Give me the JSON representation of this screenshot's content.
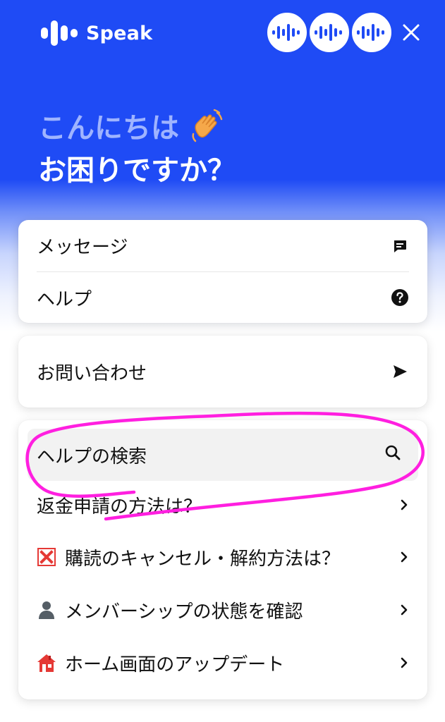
{
  "header": {
    "brand_name": "Speak",
    "accent_color": "#1f4bf5",
    "avatar_count": 3,
    "close_icon": "close-icon"
  },
  "greeting": {
    "line1": "こんにちは",
    "line2": "お困りですか？",
    "emoji": "waving-hand-icon"
  },
  "menu_card": {
    "items": [
      {
        "label": "メッセージ",
        "icon": "message-icon"
      },
      {
        "label": "ヘルプ",
        "icon": "help-circle-icon"
      }
    ]
  },
  "contact_card": {
    "label": "お問い合わせ",
    "icon": "send-arrow-icon"
  },
  "help_card": {
    "search_label": "ヘルプの検索",
    "search_icon": "search-icon",
    "faqs": [
      {
        "label": "返金申請の方法は？",
        "emoji": ""
      },
      {
        "label": "購読のキャンセル・解約方法は？",
        "emoji": "cross-mark-icon"
      },
      {
        "label": "メンバーシップの状態を確認",
        "emoji": "person-silhouette-icon"
      },
      {
        "label": "ホーム画面のアップデート",
        "emoji": "house-icon"
      }
    ]
  },
  "annotation_color": "#ff1fe0"
}
